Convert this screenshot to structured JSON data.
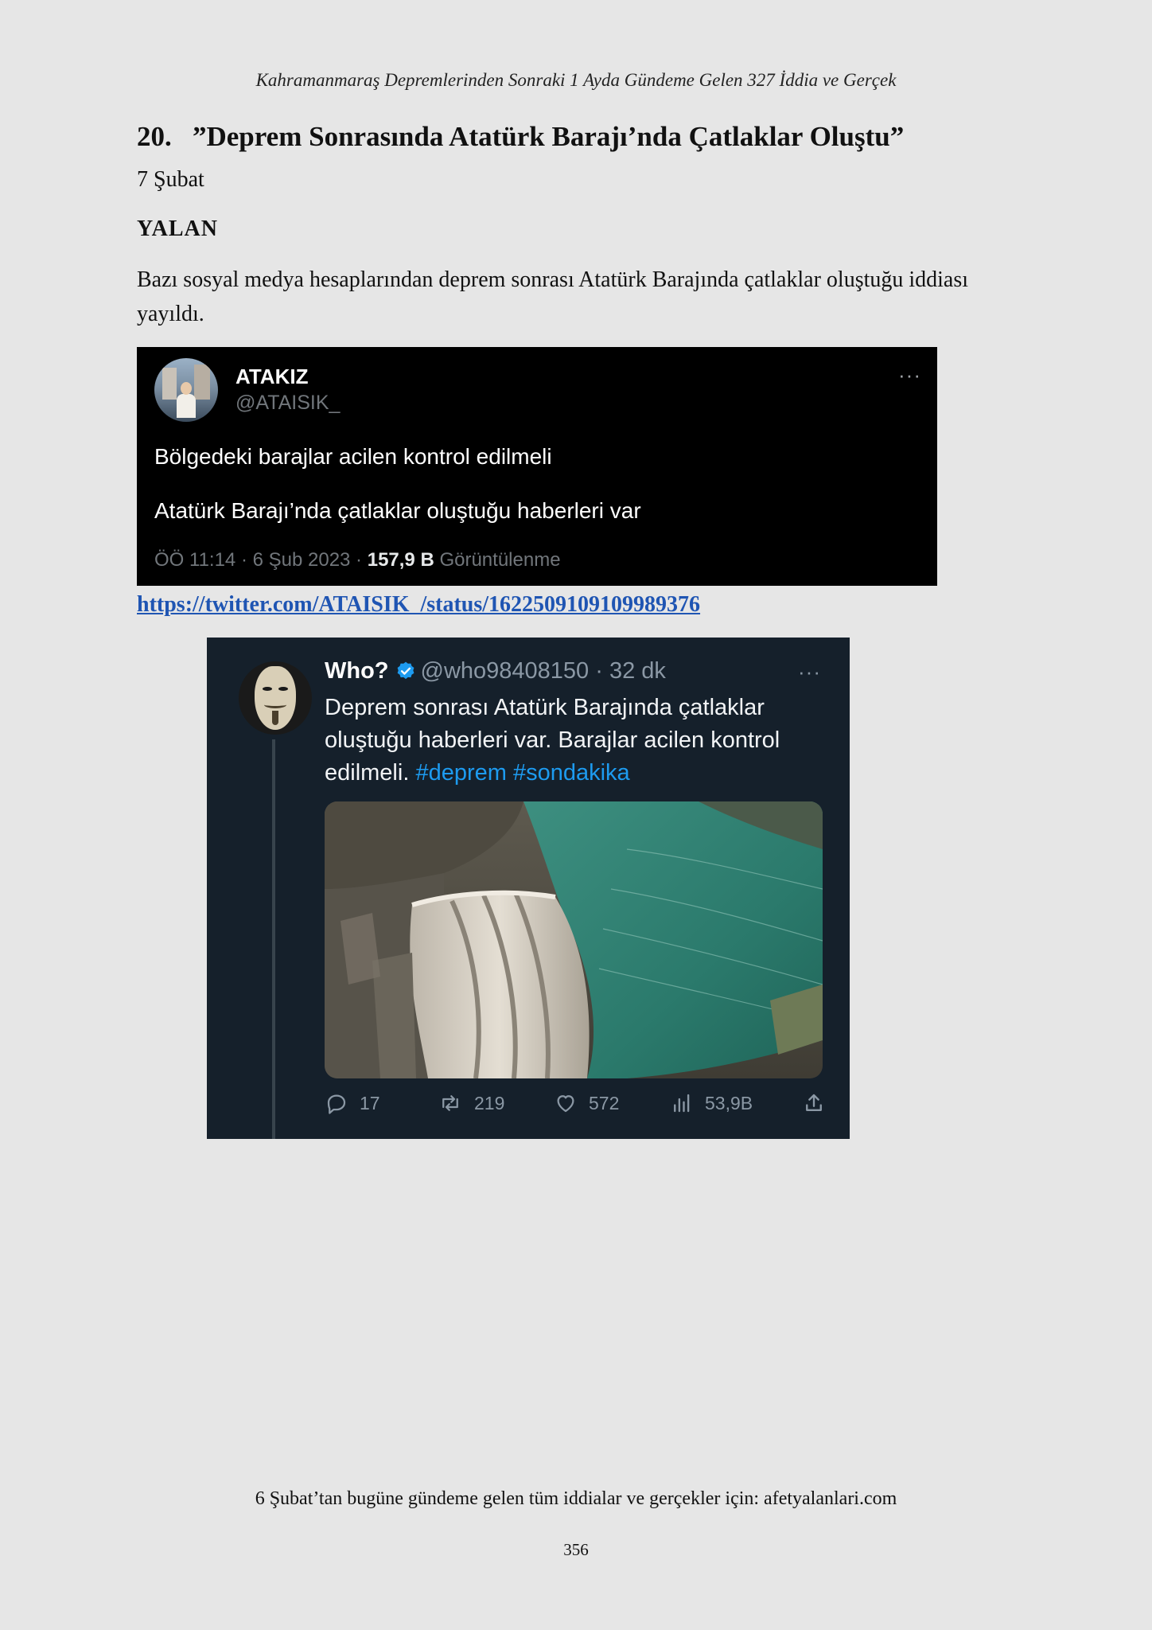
{
  "running_header": "Kahramanmaraş Depremlerinden Sonraki 1 Ayda Gündeme Gelen 327 İddia ve Gerçek",
  "claim": {
    "number": "20.",
    "title": "”Deprem Sonrasında Atatürk Barajı’nda Çatlaklar Oluştu”",
    "date": "7 Şubat",
    "verdict": "YALAN",
    "description": "Bazı sosyal medya hesaplarından deprem sonrası Atatürk Barajında çatlaklar oluştuğu iddiası yayıldı."
  },
  "tweet1": {
    "display_name": "ATAKIZ",
    "handle": "@ATAISIK_",
    "more": "···",
    "line1": "Bölgedeki barajlar acilen kontrol edilmeli",
    "line2": "Atatürk Barajı’nda çatlaklar oluştuğu haberleri var",
    "meta_prefix": "ÖÖ 11:14 · 6 Şub 2023 · ",
    "views_count": "157,9 B",
    "views_label": " Görüntülenme"
  },
  "source_link": "https://twitter.com/ATAISIK_/status/1622509109109989376",
  "tweet2": {
    "display_name": "Who?",
    "handle_time": "@who98408150 · 32 dk",
    "more": "···",
    "text": "Deprem sonrası Atatürk Barajında çatlaklar oluştuğu haberleri var. Barajlar acilen kontrol edilmeli. ",
    "hashtag1": "#deprem",
    "hashtag2": "#sondakika",
    "replies": "17",
    "retweets": "219",
    "likes": "572",
    "views": "53,9B",
    "icons": [
      "reply-icon",
      "retweet-icon",
      "like-icon",
      "views-icon",
      "share-icon"
    ],
    "verified_color": "#1d9bf0",
    "hashtag_color": "#1d9bf0"
  },
  "footer_note": "6 Şubat’tan bugüne gündeme gelen tüm iddialar ve gerçekler için: afetyalanlari.com",
  "page_number": "356"
}
